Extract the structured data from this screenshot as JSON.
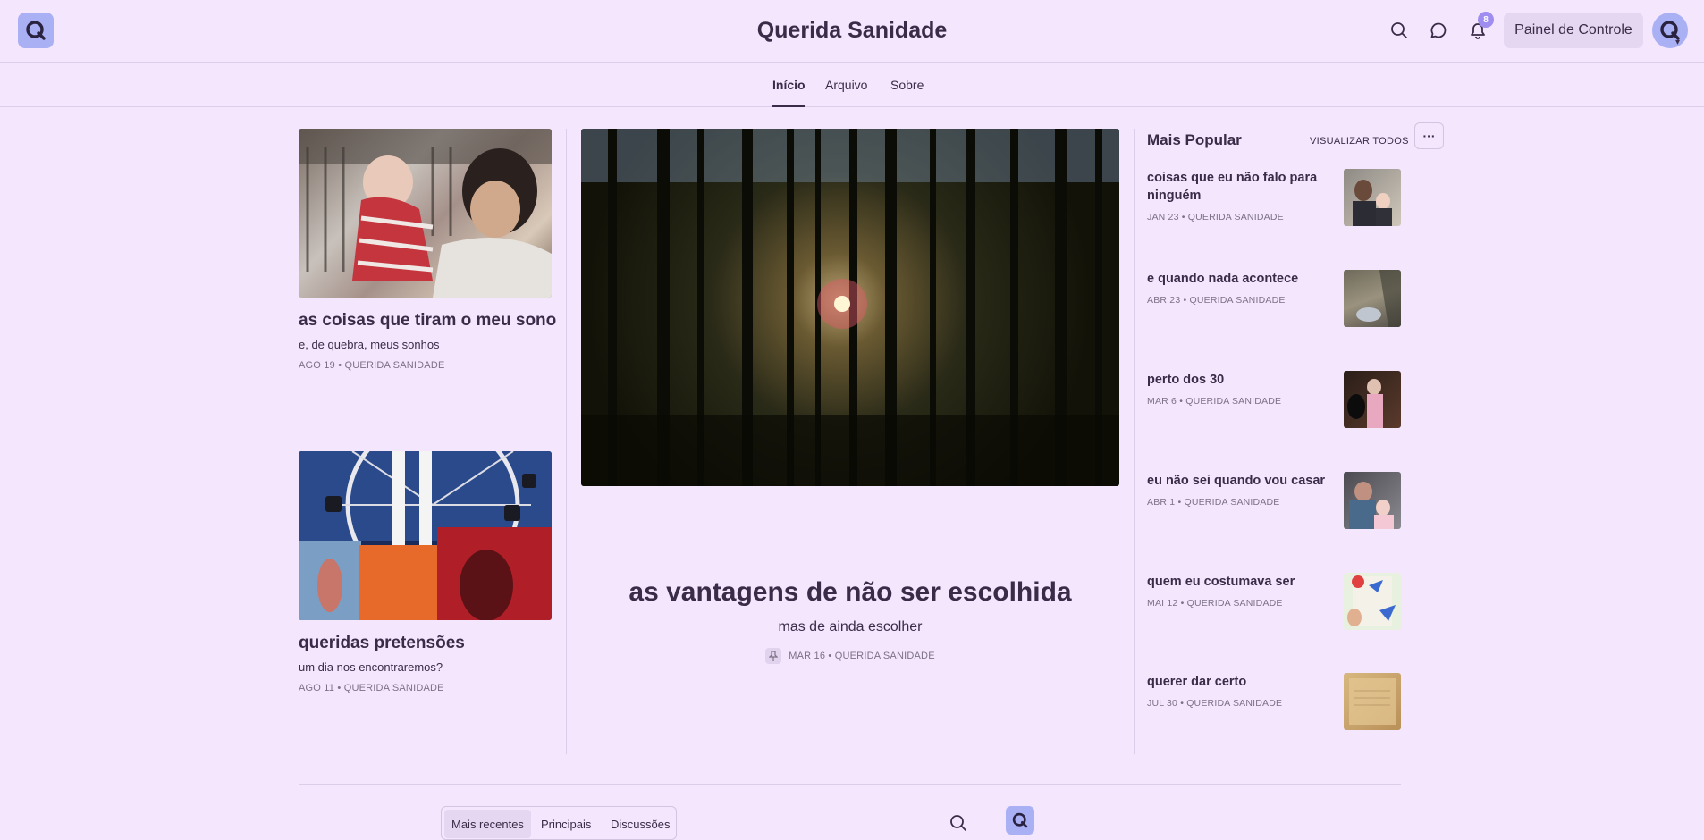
{
  "header": {
    "site_title": "Querida Sanidade",
    "notification_count": "8",
    "dashboard_label": "Painel de Controle"
  },
  "nav": {
    "tabs": [
      {
        "label": "Início",
        "active": true
      },
      {
        "label": "Arquivo",
        "active": false
      },
      {
        "label": "Sobre",
        "active": false
      }
    ]
  },
  "posts": {
    "left": [
      {
        "title": "as coisas que tiram o meu sono",
        "subtitle": "e, de quebra, meus sonhos",
        "meta": "AGO 19 • QUERIDA SANIDADE"
      },
      {
        "title": "queridas pretensões",
        "subtitle": "um dia nos encontraremos?",
        "meta": "AGO 11 • QUERIDA SANIDADE"
      }
    ],
    "hero": {
      "title": "as vantagens de não ser escolhida",
      "subtitle": "mas de ainda escolher",
      "meta": "MAR 16 • QUERIDA SANIDADE"
    }
  },
  "popular": {
    "title": "Mais Popular",
    "view_all": "VISUALIZAR TODOS",
    "more": "···",
    "items": [
      {
        "title": "coisas que eu não falo para ninguém",
        "meta": "JAN 23 • QUERIDA SANIDADE"
      },
      {
        "title": "e quando nada acontece",
        "meta": "ABR 23 • QUERIDA SANIDADE"
      },
      {
        "title": "perto dos 30",
        "meta": "MAR 6 • QUERIDA SANIDADE"
      },
      {
        "title": "eu não sei quando vou casar",
        "meta": "ABR 1 • QUERIDA SANIDADE"
      },
      {
        "title": "quem eu costumava ser",
        "meta": "MAI 12 • QUERIDA SANIDADE"
      },
      {
        "title": "querer dar certo",
        "meta": "JUL 30 • QUERIDA SANIDADE"
      }
    ]
  },
  "bottom": {
    "tabs": [
      {
        "label": "Mais recentes",
        "active": true
      },
      {
        "label": "Principais",
        "active": false
      },
      {
        "label": "Discussões",
        "active": false
      }
    ]
  }
}
